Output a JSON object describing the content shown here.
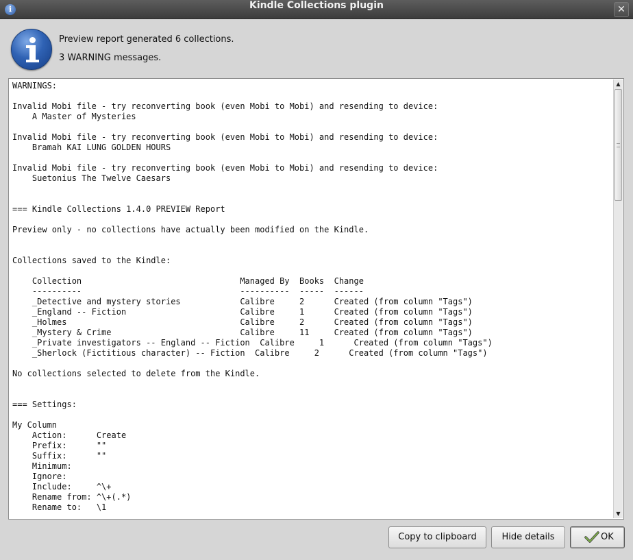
{
  "window": {
    "title": "Kindle Collections plugin",
    "close_glyph": "✕",
    "title_icon": "info-icon"
  },
  "message": {
    "line1": "Preview report generated 6 collections.",
    "line2": "3 WARNING messages."
  },
  "details": {
    "lines": [
      "WARNINGS:",
      "",
      "Invalid Mobi file - try reconverting book (even Mobi to Mobi) and resending to device:",
      "    A Master of Mysteries",
      "",
      "Invalid Mobi file - try reconverting book (even Mobi to Mobi) and resending to device:",
      "    Bramah KAI LUNG GOLDEN HOURS",
      "",
      "Invalid Mobi file - try reconverting book (even Mobi to Mobi) and resending to device:",
      "    Suetonius The Twelve Caesars",
      "",
      "",
      "=== Kindle Collections 1.4.0 PREVIEW Report",
      "",
      "Preview only - no collections have actually been modified on the Kindle.",
      "",
      "",
      "Collections saved to the Kindle:",
      "",
      "    Collection                                Managed By  Books  Change",
      "    ----------                                ----------  -----  ------",
      "    _Detective and mystery stories            Calibre     2      Created (from column \"Tags\")",
      "    _England -- Fiction                       Calibre     1      Created (from column \"Tags\")",
      "    _Holmes                                   Calibre     2      Created (from column \"Tags\")",
      "    _Mystery & Crime                          Calibre     11     Created (from column \"Tags\")",
      "    _Private investigators -- England -- Fiction  Calibre     1      Created (from column \"Tags\")",
      "    _Sherlock (Fictitious character) -- Fiction  Calibre     2      Created (from column \"Tags\")",
      "",
      "No collections selected to delete from the Kindle.",
      "",
      "",
      "=== Settings:",
      "",
      "My Column",
      "    Action:      Create",
      "    Prefix:      \"\"",
      "    Suffix:      \"\"",
      "    Minimum:",
      "    Ignore:",
      "    Include:     ^\\+",
      "    Rename from: ^\\+(.*)",
      "    Rename to:   \\1"
    ]
  },
  "buttons": {
    "copy": "Copy to clipboard",
    "hide": "Hide details",
    "ok": "OK"
  },
  "scrollbar": {
    "up_glyph": "▲",
    "down_glyph": "▼",
    "position_fraction": 0.0
  }
}
